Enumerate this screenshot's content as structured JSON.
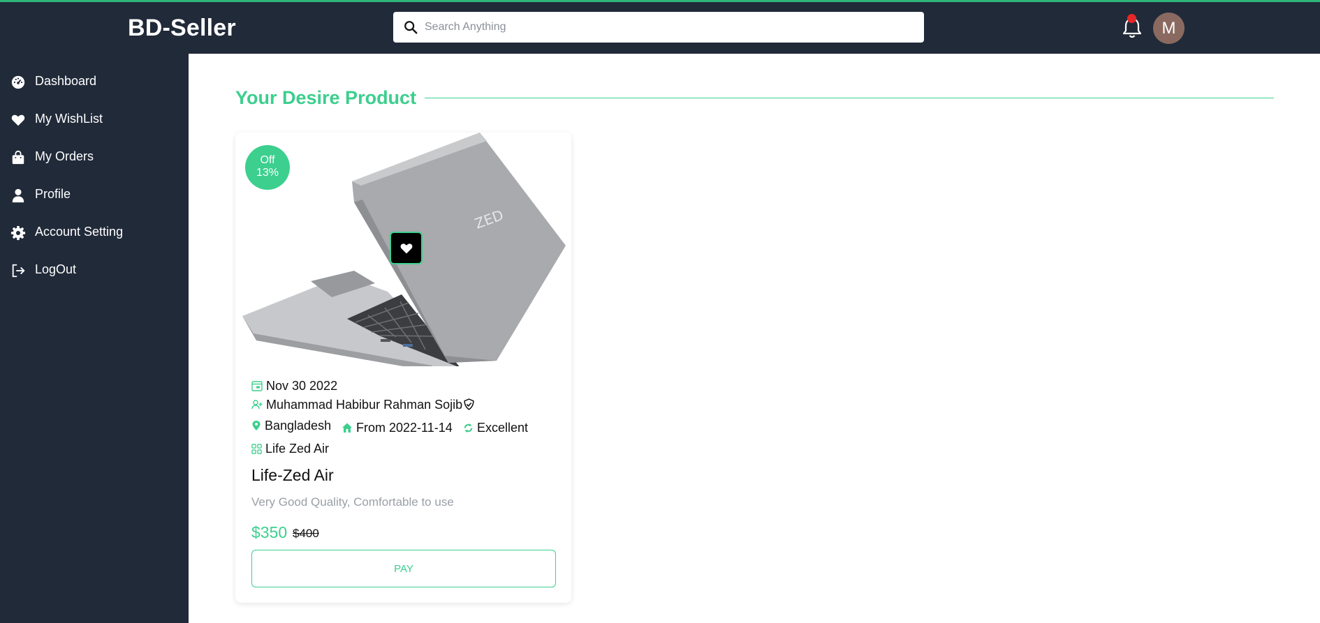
{
  "header": {
    "brand": "BD-Seller",
    "search_placeholder": "Search Anything",
    "avatar_initial": "M"
  },
  "sidebar": {
    "items": [
      {
        "label": "Dashboard",
        "icon": "dashboard-icon"
      },
      {
        "label": "My WishList",
        "icon": "heart-icon"
      },
      {
        "label": "My Orders",
        "icon": "shopping-bag-icon"
      },
      {
        "label": "Profile",
        "icon": "user-icon"
      },
      {
        "label": "Account Setting",
        "icon": "gear-icon"
      },
      {
        "label": "LogOut",
        "icon": "logout-icon"
      }
    ]
  },
  "main": {
    "title": "Your Desire Product"
  },
  "product": {
    "badge_line1": "Off",
    "badge_line2": "13%",
    "date": "Nov 30 2022",
    "seller": "Muhammad Habibur Rahman Sojib",
    "location": "Bangladesh",
    "from": "From 2022-11-14",
    "condition": "Excellent",
    "category": "Life Zed Air",
    "name": "Life-Zed Air",
    "description": "Very Good Quality, Comfortable to use",
    "price": "$350",
    "old_price": "$400",
    "pay_label": "PAY"
  },
  "colors": {
    "accent": "#3ccf8e",
    "dark": "#212a39",
    "notification": "#e52727"
  }
}
